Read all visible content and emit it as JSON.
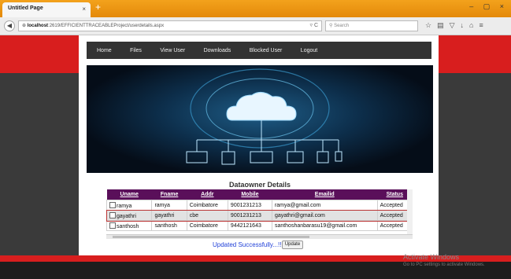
{
  "browser": {
    "tab_title": "Untitled Page",
    "tab_close": "×",
    "new_tab": "+",
    "url_host": "localhost",
    "url_path": ":2619/EFFICIENTTRACEABLEProject/userdetails.aspx",
    "search_placeholder": "Search",
    "window_controls": "– ▢ ×",
    "toolbar_icons": [
      "star-icon",
      "reading-list-icon",
      "pocket-icon",
      "download-icon",
      "home-icon",
      "menu-icon"
    ]
  },
  "menu": {
    "items": [
      "Home",
      "Files",
      "View User",
      "Downloads",
      "Blocked User",
      "Logout"
    ]
  },
  "section_title": "Dataowner Details",
  "table": {
    "headers": [
      "Uname",
      "Fname",
      "Addr",
      "Mobile",
      "Emailid",
      "Status"
    ],
    "rows": [
      {
        "uname": "ramya",
        "fname": "ramya",
        "addr": "Coimbatore",
        "mobile": "9001231213",
        "email": "ramya@gmail.com",
        "status": "Accepted"
      },
      {
        "uname": "gayathri",
        "fname": "gayathri",
        "addr": "cbe",
        "mobile": "9001231213",
        "email": "gayathri@gmail.com",
        "status": "Accepted"
      },
      {
        "uname": "santhosh",
        "fname": "santhosh",
        "addr": "Coimbatore",
        "mobile": "9442121643",
        "email": "santhoshanbarasu19@gmail.com",
        "status": "Accepted"
      }
    ]
  },
  "status_message": "Updated Successfully...!!!",
  "update_button": "Update",
  "watermark": {
    "line1": "Activate Windows",
    "line2": "Go to PC settings to activate Windows."
  },
  "colors": {
    "accent_red": "#d81e1e",
    "table_header": "#5a0f5a",
    "message_blue": "#1f3fd8"
  }
}
